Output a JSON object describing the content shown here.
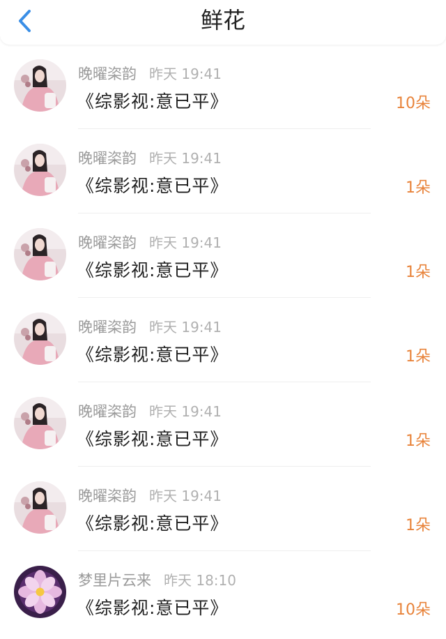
{
  "header": {
    "title": "鲜花",
    "back_icon": "chevron-left-icon",
    "accent_color": "#3a8ee6"
  },
  "colors": {
    "count": "#e8833a",
    "name": "#9a9a9a"
  },
  "rows": [
    {
      "name": "晚曜栥韵",
      "time": "昨天 19:41",
      "book": "《综影视:意已平》",
      "count": "10朵",
      "avatar": "girl-avatar"
    },
    {
      "name": "晚曜栥韵",
      "time": "昨天 19:41",
      "book": "《综影视:意已平》",
      "count": "1朵",
      "avatar": "girl-avatar"
    },
    {
      "name": "晚曜栥韵",
      "time": "昨天 19:41",
      "book": "《综影视:意已平》",
      "count": "1朵",
      "avatar": "girl-avatar"
    },
    {
      "name": "晚曜栥韵",
      "time": "昨天 19:41",
      "book": "《综影视:意已平》",
      "count": "1朵",
      "avatar": "girl-avatar"
    },
    {
      "name": "晚曜栥韵",
      "time": "昨天 19:41",
      "book": "《综影视:意已平》",
      "count": "1朵",
      "avatar": "girl-avatar"
    },
    {
      "name": "晚曜栥韵",
      "time": "昨天 19:41",
      "book": "《综影视:意已平》",
      "count": "1朵",
      "avatar": "girl-avatar"
    },
    {
      "name": "梦里片云来",
      "time": "昨天 18:10",
      "book": "《综影视:意已平》",
      "count": "10朵",
      "avatar": "flower-avatar"
    }
  ]
}
